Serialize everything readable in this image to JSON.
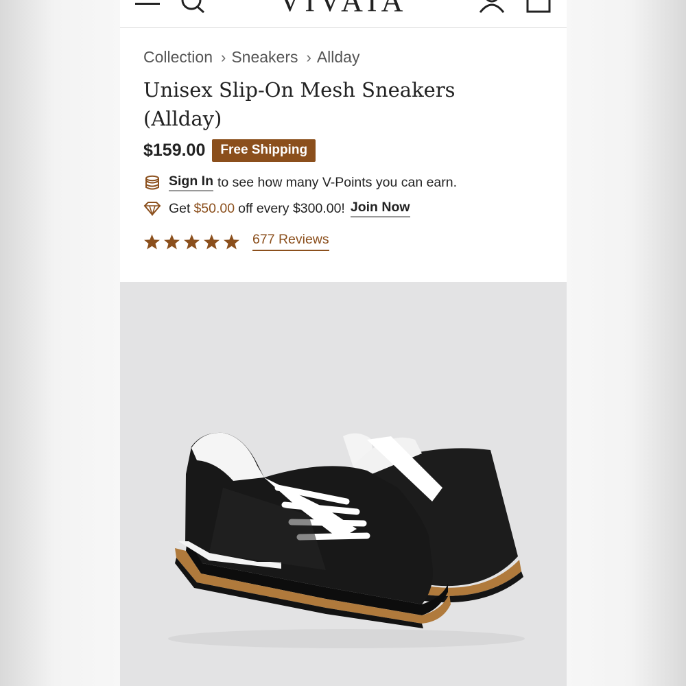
{
  "header": {
    "logo": "VIVAIA",
    "icons": [
      "menu-icon",
      "search-icon",
      "account-icon",
      "shopping-bag-icon"
    ]
  },
  "breadcrumb": [
    "Collection",
    "Sneakers",
    "Allday"
  ],
  "product": {
    "title": "Unisex Slip-On Mesh Sneakers (Allday)",
    "price": "$159.00",
    "shipping_badge": "Free Shipping"
  },
  "promos": {
    "signin_link": "Sign In",
    "signin_text": "to see how many V-Points you can earn.",
    "get_text": "Get",
    "discount_amount": "$50.00",
    "discount_text": "off every $300.00!",
    "join_link": "Join Now"
  },
  "rating": {
    "stars": 5,
    "reviews_label": "677 Reviews"
  },
  "colors": {
    "accent": "#8b4f1c",
    "text": "#222222",
    "image_bg": "#e3e3e4"
  }
}
